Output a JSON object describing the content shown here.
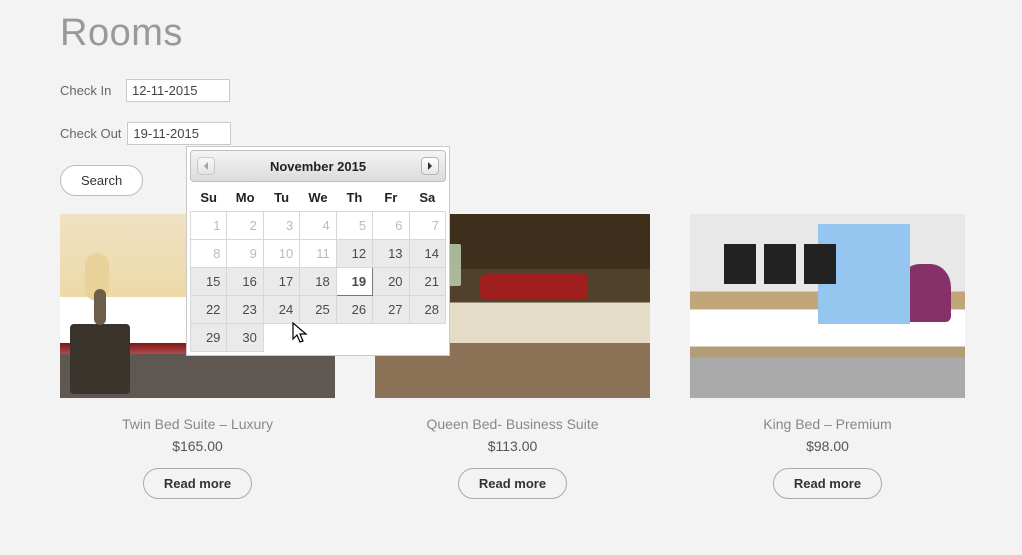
{
  "page": {
    "title": "Rooms"
  },
  "form": {
    "checkin_label": "Check In",
    "checkin_value": "12-11-2015",
    "checkout_label": "Check Out",
    "checkout_value": "19-11-2015",
    "search_label": "Search"
  },
  "datepicker": {
    "month_label": "November 2015",
    "days": [
      "Su",
      "Mo",
      "Tu",
      "We",
      "Th",
      "Fr",
      "Sa"
    ],
    "selected_day": 19,
    "weeks": [
      [
        {
          "n": 1,
          "past": true
        },
        {
          "n": 2,
          "past": true
        },
        {
          "n": 3,
          "past": true
        },
        {
          "n": 4,
          "past": true
        },
        {
          "n": 5,
          "past": true
        },
        {
          "n": 6,
          "past": true
        },
        {
          "n": 7,
          "past": true
        }
      ],
      [
        {
          "n": 8,
          "past": true
        },
        {
          "n": 9,
          "past": true
        },
        {
          "n": 10,
          "past": true
        },
        {
          "n": 11,
          "past": true
        },
        {
          "n": 12
        },
        {
          "n": 13
        },
        {
          "n": 14
        }
      ],
      [
        {
          "n": 15
        },
        {
          "n": 16
        },
        {
          "n": 17
        },
        {
          "n": 18
        },
        {
          "n": 19,
          "selected": true
        },
        {
          "n": 20
        },
        {
          "n": 21
        }
      ],
      [
        {
          "n": 22
        },
        {
          "n": 23
        },
        {
          "n": 24
        },
        {
          "n": 25
        },
        {
          "n": 26
        },
        {
          "n": 27
        },
        {
          "n": 28
        }
      ],
      [
        {
          "n": 29
        },
        {
          "n": 30
        },
        {
          "blank": true
        },
        {
          "blank": true
        },
        {
          "blank": true
        },
        {
          "blank": true
        },
        {
          "blank": true
        }
      ]
    ]
  },
  "products": [
    {
      "title": "Twin Bed Suite – Luxury",
      "price": "$165.00",
      "button": "Read more"
    },
    {
      "title": "Queen Bed- Business Suite",
      "price": "$113.00",
      "button": "Read more"
    },
    {
      "title": "King Bed – Premium",
      "price": "$98.00",
      "button": "Read more"
    }
  ]
}
